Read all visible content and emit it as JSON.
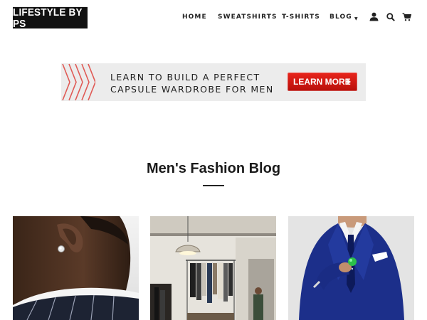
{
  "header": {
    "logo": "LIFESTYLE BY PS",
    "nav": [
      {
        "label": "HOME"
      },
      {
        "label": "SWEATSHIRTS"
      },
      {
        "label": "T-SHIRTS"
      },
      {
        "label": "BLOG"
      }
    ],
    "icons": [
      "user-icon",
      "search-icon",
      "cart-icon"
    ]
  },
  "banner": {
    "line1": "LEARN TO BUILD A PERFECT",
    "line2": "CAPSULE WARDROBE FOR MEN",
    "button": "LEARN MORE",
    "accent": "#d9231b"
  },
  "main": {
    "title": "Men's Fashion Blog"
  },
  "posts": [
    {
      "image": "earring-photo"
    },
    {
      "image": "clothing-store-photo"
    },
    {
      "image": "navy-suit-photo"
    }
  ]
}
